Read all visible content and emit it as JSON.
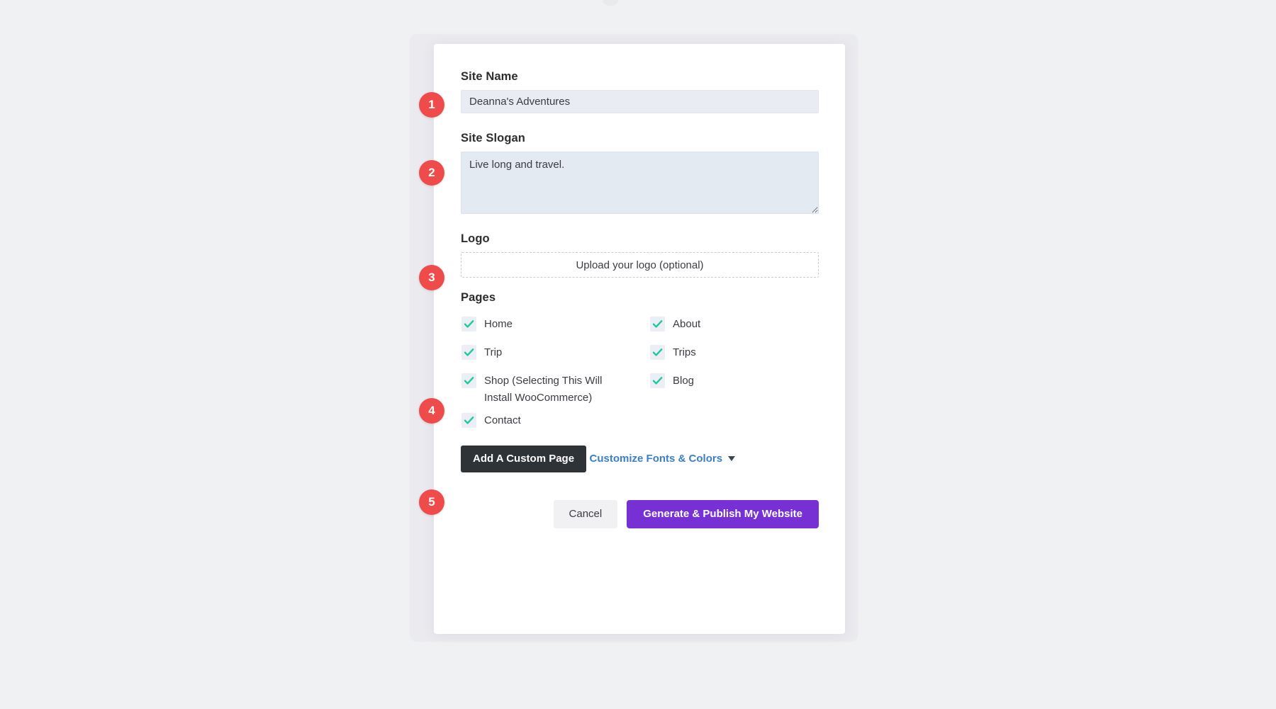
{
  "theme": {
    "page_background": "#f0f1f2",
    "card_background": "#ffffff",
    "badge_color": "#ef4b4b",
    "primary_button_color": "#7630d4",
    "dark_button_color": "#2e3338",
    "link_color": "#3b7fc4",
    "checkbox_check_color": "#1bc99a",
    "input_background": "#e9edf3"
  },
  "form": {
    "site_name": {
      "label": "Site Name",
      "value": "Deanna's Adventures",
      "placeholder": ""
    },
    "site_slogan": {
      "label": "Site Slogan",
      "value": "Live long and travel.",
      "placeholder": ""
    },
    "logo": {
      "label": "Logo",
      "dropzone_text": "Upload your logo (optional)"
    },
    "pages": {
      "label": "Pages",
      "items": [
        {
          "label": "Home",
          "checked": true
        },
        {
          "label": "About",
          "checked": true
        },
        {
          "label": "Trip",
          "checked": true
        },
        {
          "label": "Trips",
          "checked": true
        },
        {
          "label": "Shop (Selecting This Will Install WooCommerce)",
          "checked": true
        },
        {
          "label": "Blog",
          "checked": true
        },
        {
          "label": "Contact",
          "checked": true
        }
      ]
    },
    "add_custom_page_label": "Add A Custom Page",
    "customize_link_label": "Customize Fonts & Colors"
  },
  "footer": {
    "cancel_label": "Cancel",
    "generate_label": "Generate & Publish My Website"
  },
  "step_badges": [
    {
      "number": "1"
    },
    {
      "number": "2"
    },
    {
      "number": "3"
    },
    {
      "number": "4"
    },
    {
      "number": "5"
    }
  ]
}
